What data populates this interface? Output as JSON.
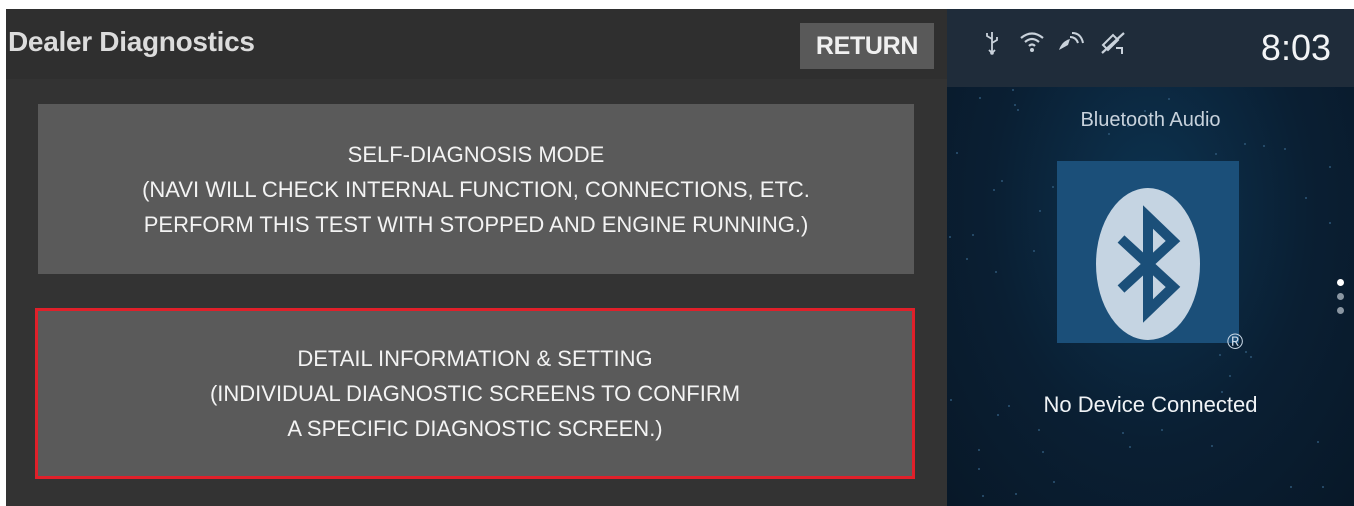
{
  "diagnostics": {
    "title": "Dealer Diagnostics",
    "return_label": "RETURN",
    "self_diagnosis": {
      "line1": "SELF-DIAGNOSIS MODE",
      "line2": "(NAVI WILL CHECK INTERNAL FUNCTION, CONNECTIONS, ETC.",
      "line3": "PERFORM THIS TEST WITH STOPPED AND ENGINE RUNNING.)"
    },
    "detail_info": {
      "line1": "DETAIL INFORMATION & SETTING",
      "line2": "(INDIVIDUAL DIAGNOSTIC SCREENS TO CONFIRM",
      "line3": "A SPECIFIC DIAGNOSTIC SCREEN.)",
      "selected": true
    }
  },
  "status_bar": {
    "icons": [
      "usb-icon",
      "wifi-icon",
      "signal-icon",
      "gps-off-icon"
    ],
    "clock": "8:03"
  },
  "audio_panel": {
    "title": "Bluetooth Audio",
    "registered_mark": "®",
    "status": "No Device Connected",
    "page_dots": 3,
    "active_page": 1
  },
  "colors": {
    "selection_border": "#e0202a",
    "bluetooth_tile": "#1b4f79"
  }
}
